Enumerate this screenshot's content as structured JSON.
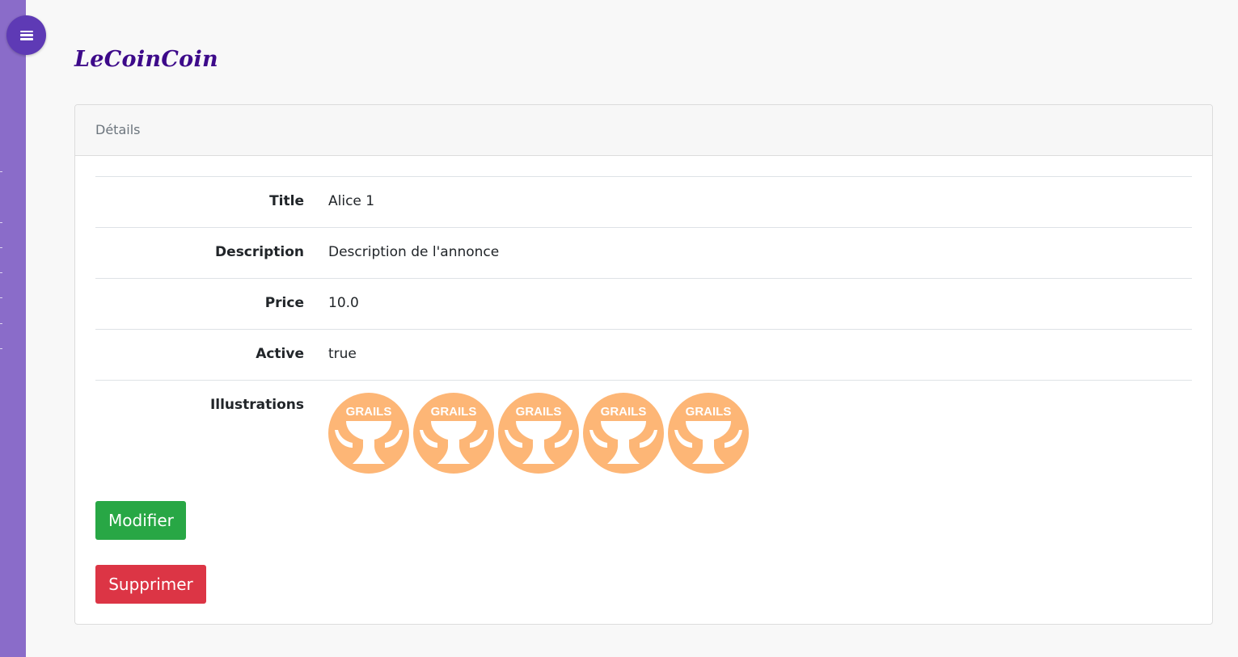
{
  "app": {
    "brand": "LeCoinCoin"
  },
  "colors": {
    "sidebar": "#8a6cc9",
    "menu_button": "#5e3ab5",
    "brand": "#3d0a8a",
    "edit": "#28a745",
    "delete": "#dc3545",
    "grail": "#fdb676"
  },
  "card": {
    "header": "Détails"
  },
  "fields": [
    {
      "label": "Title",
      "value": "Alice 1"
    },
    {
      "label": "Description",
      "value": "Description de l'annonce"
    },
    {
      "label": "Price",
      "value": "10.0"
    },
    {
      "label": "Active",
      "value": "true"
    }
  ],
  "illustrations": {
    "label": "Illustrations",
    "items": [
      {
        "icon": "grails-logo-icon",
        "text": "GRAILS"
      },
      {
        "icon": "grails-logo-icon",
        "text": "GRAILS"
      },
      {
        "icon": "grails-logo-icon",
        "text": "GRAILS"
      },
      {
        "icon": "grails-logo-icon",
        "text": "GRAILS"
      },
      {
        "icon": "grails-logo-icon",
        "text": "GRAILS"
      }
    ]
  },
  "actions": {
    "edit_label": "Modifier",
    "delete_label": "Supprimer"
  },
  "menu": {
    "icon": "hamburger-menu-icon"
  }
}
